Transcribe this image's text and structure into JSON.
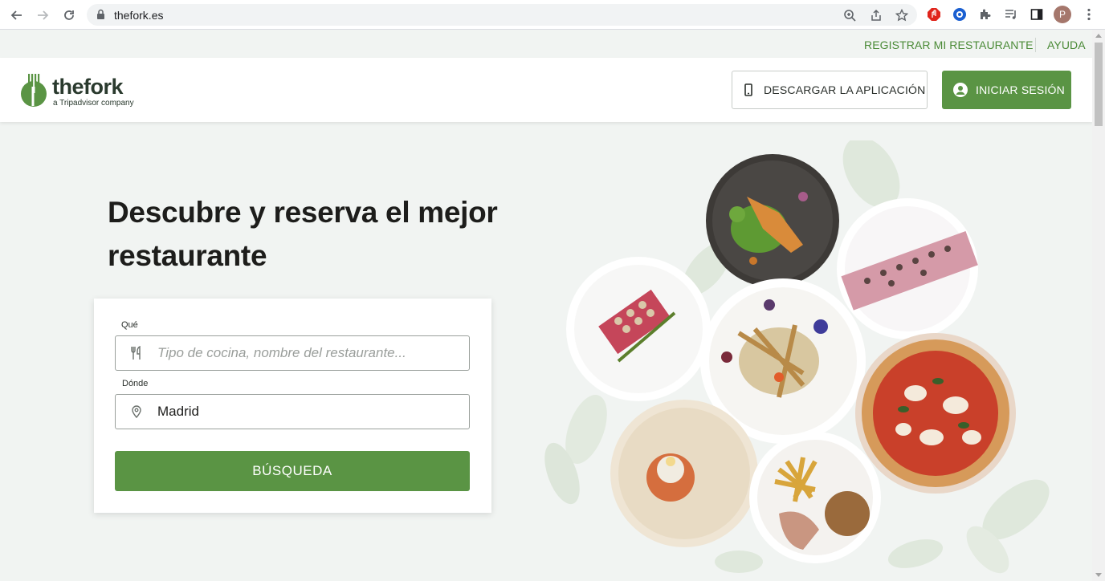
{
  "browser": {
    "url": "thefork.es",
    "profile_initial": "P"
  },
  "utility_nav": {
    "register_label": "REGISTRAR MI RESTAURANTE",
    "help_label": "AYUDA"
  },
  "header": {
    "logo_word": "thefork",
    "logo_tagline": "a Tripadvisor company",
    "download_app_label": "DESCARGAR LA APLICACIÓN",
    "login_label": "INICIAR SESIÓN"
  },
  "hero": {
    "headline_line1": "Descubre y reserva el mejor",
    "headline_line2": "restaurante"
  },
  "search": {
    "what_label": "Qué",
    "what_placeholder": "Tipo de cocina, nombre del restaurante...",
    "where_label": "Dónde",
    "where_value": "Madrid",
    "submit_label": "BÚSQUEDA"
  },
  "colors": {
    "brand_green": "#5a9444",
    "link_green": "#4a8a36",
    "page_bg": "#f1f4f2"
  }
}
